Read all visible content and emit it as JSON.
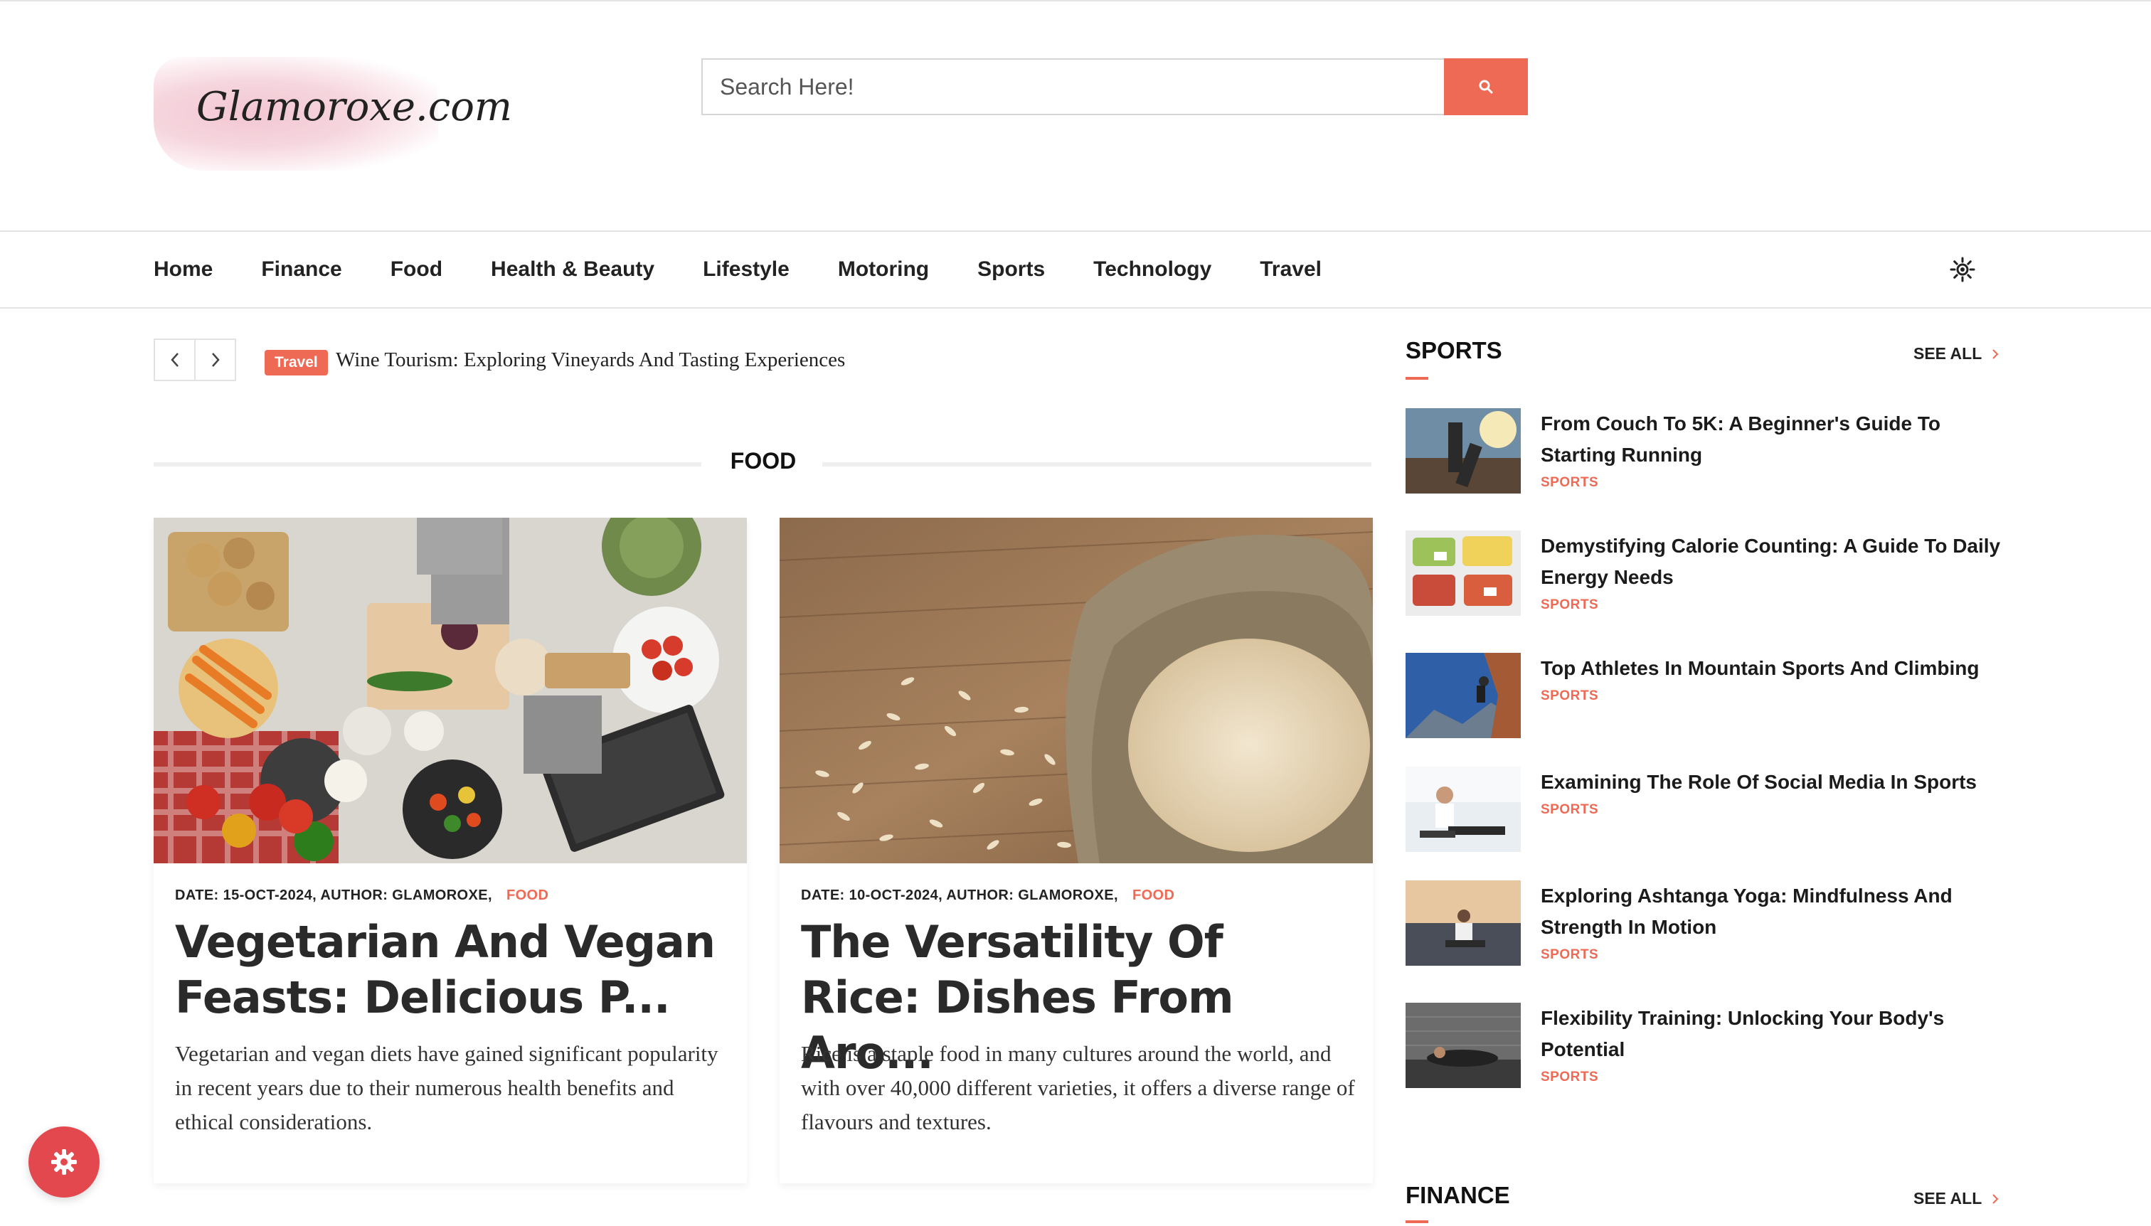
{
  "header": {
    "logo_text": "Glamoroxe.com",
    "search_placeholder": "Search Here!"
  },
  "nav": {
    "items": [
      "Home",
      "Finance",
      "Food",
      "Health & Beauty",
      "Lifestyle",
      "Motoring",
      "Sports",
      "Technology",
      "Travel"
    ]
  },
  "ticker": {
    "badge": "Travel",
    "headline": "Wine Tourism: Exploring Vineyards And Tasting Experiences"
  },
  "food_section": {
    "title": "FOOD",
    "cards": [
      {
        "meta": "DATE: 15-OCT-2024, AUTHOR: GLAMOROXE,",
        "category": "FOOD",
        "title": "Vegetarian And Vegan Feasts: Delicious P...",
        "excerpt": "Vegetarian and vegan diets have gained significant popularity in recent years due to their numerous health benefits and ethical considerations."
      },
      {
        "meta": "DATE: 10-OCT-2024, AUTHOR: GLAMOROXE,",
        "category": "FOOD",
        "title": "The Versatility Of Rice: Dishes From Aro...",
        "excerpt": "Rice is a staple food in many cultures around the world, and with over 40,000 different varieties, it offers a diverse range of flavours and textures."
      }
    ]
  },
  "sidebar": {
    "sports": {
      "title": "SPORTS",
      "see_all": "SEE ALL",
      "items": [
        {
          "title": "From Couch To 5K: A Beginner's Guide To Starting Running",
          "category": "SPORTS"
        },
        {
          "title": "Demystifying Calorie Counting: A Guide To Daily Energy Needs",
          "category": "SPORTS"
        },
        {
          "title": "Top Athletes In Mountain Sports And Climbing",
          "category": "SPORTS"
        },
        {
          "title": "Examining The Role Of Social Media In Sports",
          "category": "SPORTS"
        },
        {
          "title": "Exploring Ashtanga Yoga: Mindfulness And Strength In Motion",
          "category": "SPORTS"
        },
        {
          "title": "Flexibility Training: Unlocking Your Body's Potential",
          "category": "SPORTS"
        }
      ]
    },
    "finance": {
      "title": "FINANCE",
      "see_all": "SEE ALL"
    }
  },
  "colors": {
    "accent": "#ee6a55",
    "fab": "#e4484f",
    "text": "#1b1b1b"
  },
  "icons": {
    "search": "search-icon",
    "theme": "sun-icon",
    "prev": "chevron-left-icon",
    "next": "chevron-right-icon",
    "settings": "gear-icon"
  }
}
